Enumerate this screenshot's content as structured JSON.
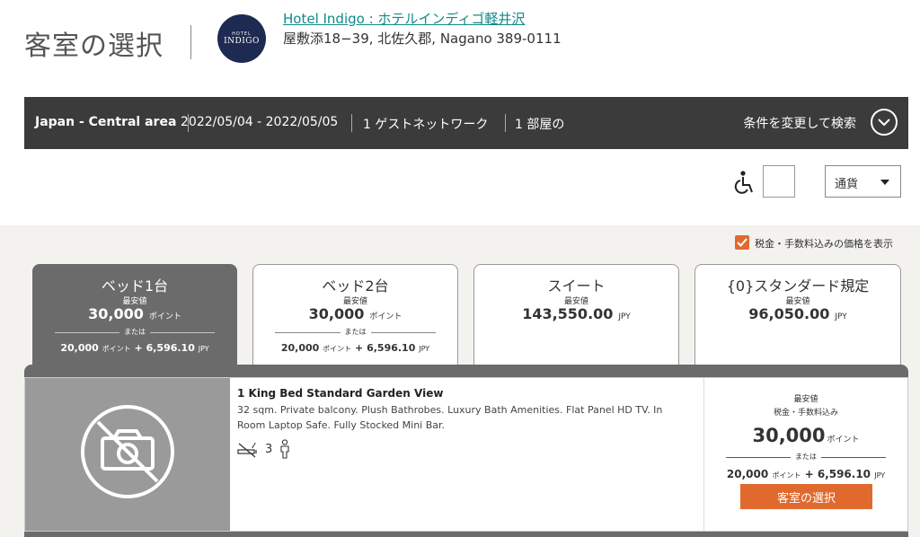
{
  "header": {
    "title": "客室の選択",
    "logo_line1": "HOTEL",
    "logo_line2": "INDIGO",
    "hotel_name": "Hotel Indigo : ホテルインディゴ軽井沢",
    "address": "屋敷添18−39, 北佐久郡, Nagano 389-0111"
  },
  "search": {
    "area": "Japan - Central area",
    "dates": "2022/05/04 - 2022/05/05",
    "guests": "1 ゲストネットワーク",
    "rooms": "1 部屋の",
    "modify_label": "条件を変更して検索"
  },
  "filters": {
    "currency": "通貨"
  },
  "tax_toggle_label": "税金・手数料込みの価格を表示",
  "tabs": [
    {
      "name": "ベッド1台",
      "low_label": "最安値",
      "price": "30,000",
      "unit": "ポイント",
      "or": "または",
      "combo_points": "20,000",
      "combo_points_unit": "ポイント",
      "combo_plus": "+",
      "combo_cash": "6,596.10",
      "combo_cash_unit": "JPY"
    },
    {
      "name": "ベッド2台",
      "low_label": "最安値",
      "price": "30,000",
      "unit": "ポイント",
      "or": "または",
      "combo_points": "20,000",
      "combo_points_unit": "ポイント",
      "combo_plus": "+",
      "combo_cash": "6,596.10",
      "combo_cash_unit": "JPY"
    },
    {
      "name": "スイート",
      "low_label": "最安値",
      "price": "143,550.00",
      "unit": "JPY"
    },
    {
      "name": "{0}スタンダード規定",
      "low_label": "最安値",
      "price": "96,050.00",
      "unit": "JPY"
    }
  ],
  "room": {
    "title": "1 King Bed Standard Garden View",
    "description": "32 sqm. Private balcony. Plush Bathrobes. Luxury Bath Amenities. Flat Panel HD TV. In Room Laptop Safe. Fully Stocked Mini Bar.",
    "occupancy": "3",
    "low_label": "最安値",
    "tax_label": "税金・手数料込み",
    "price": "30,000",
    "price_unit": "ポイント",
    "or": "または",
    "combo_points": "20,000",
    "combo_points_unit": "ポイント",
    "combo_plus": "+",
    "combo_cash": "6,596.10",
    "combo_cash_unit": "JPY",
    "select_label": "客室の選択"
  }
}
